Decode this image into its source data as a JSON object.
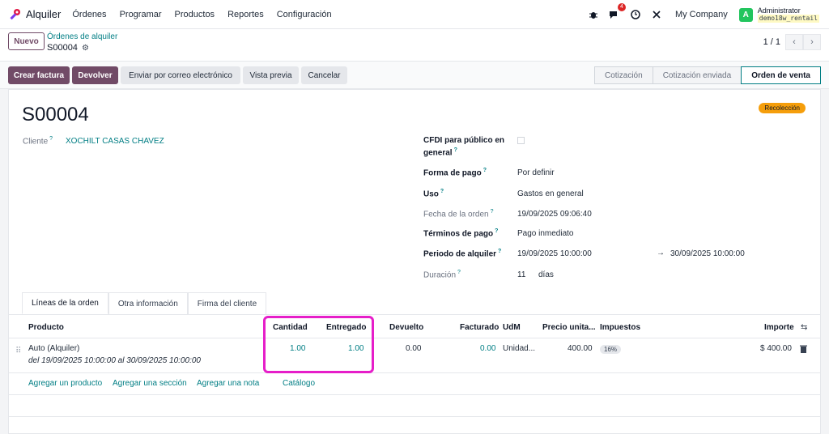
{
  "nav": {
    "app_name": "Alquiler",
    "menu": [
      "Órdenes",
      "Programar",
      "Productos",
      "Reportes",
      "Configuración"
    ],
    "message_count": "4",
    "company": "My Company",
    "avatar_letter": "A",
    "user_name": "Administrator",
    "user_db": "demo18w_rentail"
  },
  "control": {
    "new_label": "Nuevo",
    "breadcrumb": "Órdenes de alquiler",
    "record": "S00004",
    "pager": "1 / 1"
  },
  "actions": {
    "create_invoice": "Crear factura",
    "return": "Devolver",
    "send_email": "Enviar por correo electrónico",
    "preview": "Vista previa",
    "cancel": "Cancelar"
  },
  "stages": [
    "Cotización",
    "Cotización enviada",
    "Orden de venta"
  ],
  "active_stage": "Orden de venta",
  "form": {
    "title": "S00004",
    "tag": "Recolección",
    "customer_label": "Cliente",
    "customer": "XOCHILT CASAS CHAVEZ",
    "cfdi_label_1": "CFDI para público en",
    "cfdi_label_2": "general",
    "payment_method_label": "Forma de pago",
    "payment_method": "Por definir",
    "usage_label": "Uso",
    "usage": "Gastos en general",
    "order_date_label": "Fecha de la orden",
    "order_date": "19/09/2025 09:06:40",
    "payment_terms_label": "Términos de pago",
    "payment_terms": "Pago inmediato",
    "rental_period_label": "Periodo de alquiler",
    "rental_start": "19/09/2025 10:00:00",
    "rental_end": "30/09/2025 10:00:00",
    "duration_label": "Duración",
    "duration_value": "11",
    "duration_unit": "días"
  },
  "tabs": [
    "Líneas de la orden",
    "Otra información",
    "Firma del cliente"
  ],
  "table": {
    "headers": {
      "product": "Producto",
      "qty": "Cantidad",
      "delivered": "Entregado",
      "returned": "Devuelto",
      "invoiced": "Facturado",
      "uom": "UdM",
      "unit_price": "Precio unita...",
      "taxes": "Impuestos",
      "amount": "Importe"
    },
    "rows": [
      {
        "product": "Auto (Alquiler)",
        "period": "del 19/09/2025 10:00:00 al 30/09/2025 10:00:00",
        "qty": "1.00",
        "delivered": "1.00",
        "returned": "0.00",
        "invoiced": "0.00",
        "uom": "Unidad...",
        "unit_price": "400.00",
        "tax": "16%",
        "amount": "$ 400.00"
      }
    ],
    "add_links": {
      "product": "Agregar un producto",
      "section": "Agregar una sección",
      "note": "Agregar una nota",
      "catalog": "Catálogo"
    }
  },
  "colors": {
    "primary": "#714b67",
    "link": "#017e84",
    "highlight": "#e61ec9",
    "tag": "#f59e0b"
  }
}
